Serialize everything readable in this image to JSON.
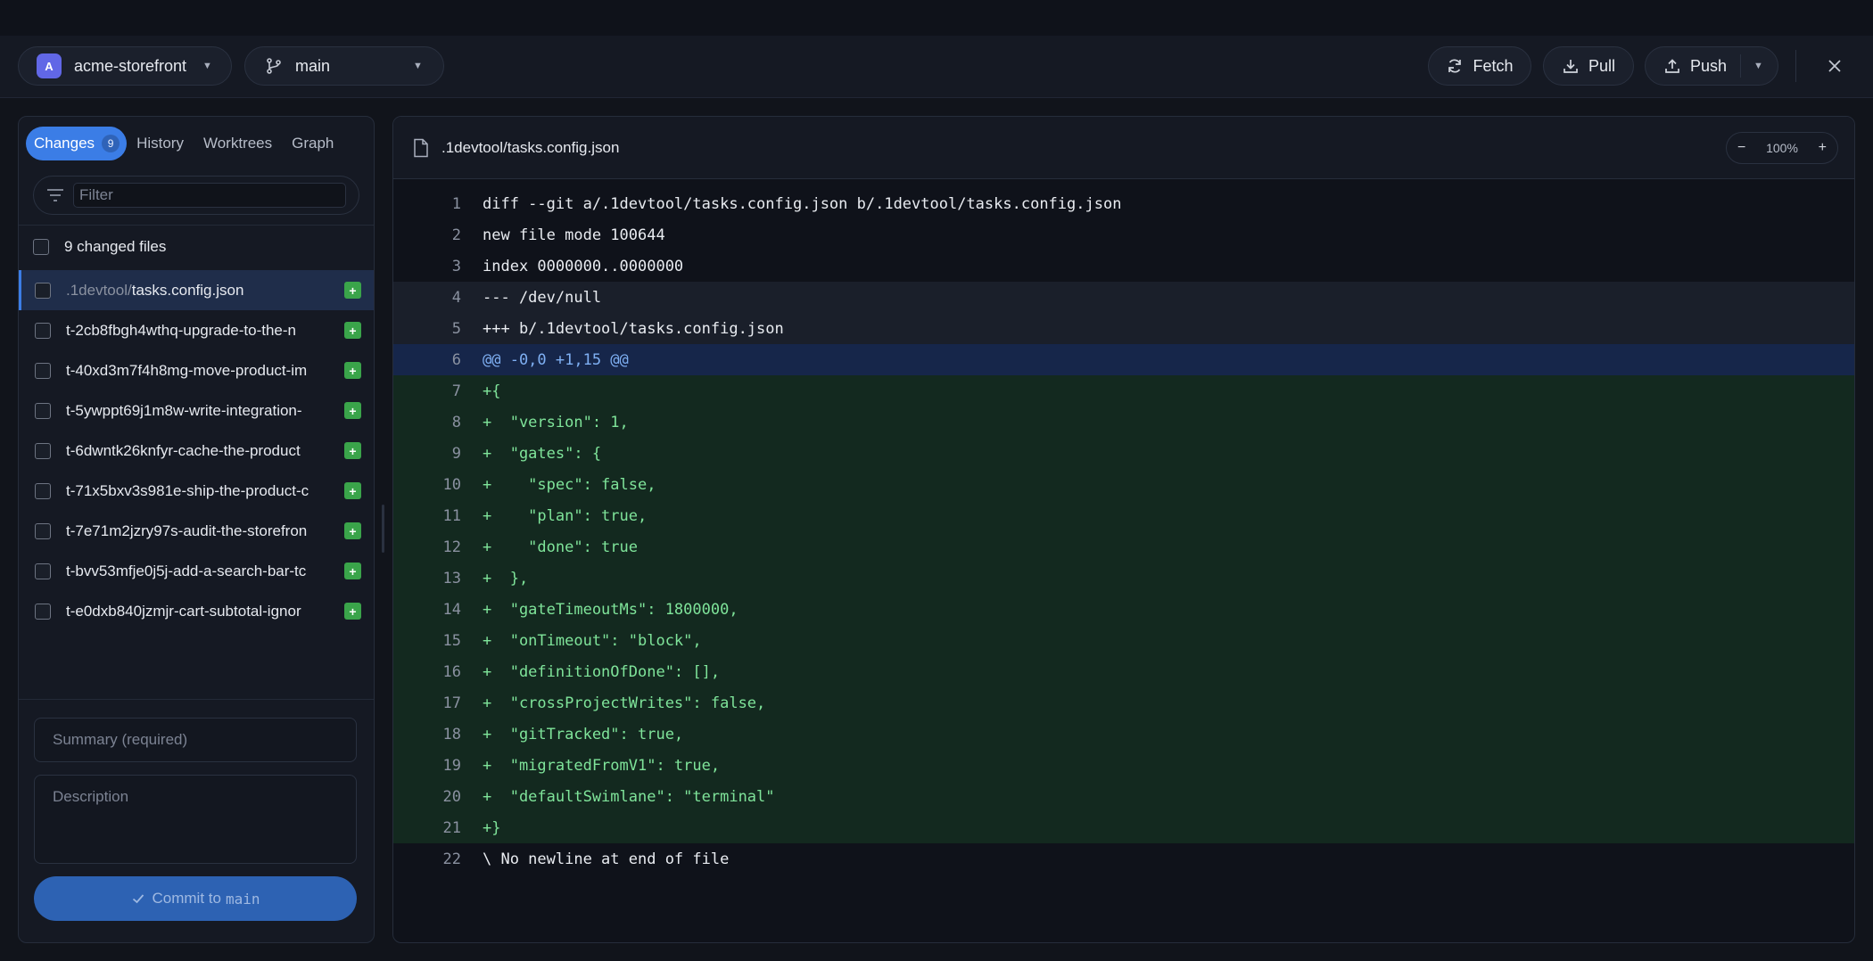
{
  "toolbar": {
    "repo": {
      "avatar_letter": "A",
      "name": "acme-storefront"
    },
    "branch": "main",
    "fetch_label": "Fetch",
    "pull_label": "Pull",
    "push_label": "Push"
  },
  "sidebar": {
    "tabs": [
      {
        "label": "Changes",
        "badge": "9"
      },
      {
        "label": "History"
      },
      {
        "label": "Worktrees"
      },
      {
        "label": "Graph"
      }
    ],
    "filter_placeholder": "Filter",
    "changed_files_label": "9 changed files",
    "files": [
      {
        "dir": ".1devtool/",
        "name": "tasks.config.json",
        "status": "+"
      },
      {
        "dir": "",
        "name": "t-2cb8fbgh4wthq-upgrade-to-the-n",
        "status": "+"
      },
      {
        "dir": "",
        "name": "t-40xd3m7f4h8mg-move-product-im",
        "status": "+"
      },
      {
        "dir": "",
        "name": "t-5ywppt69j1m8w-write-integration-",
        "status": "+"
      },
      {
        "dir": "",
        "name": "t-6dwntk26knfyr-cache-the-product",
        "status": "+"
      },
      {
        "dir": "",
        "name": "t-71x5bxv3s981e-ship-the-product-c",
        "status": "+"
      },
      {
        "dir": "",
        "name": "t-7e71m2jzry97s-audit-the-storefron",
        "status": "+"
      },
      {
        "dir": "",
        "name": "t-bvv53mfje0j5j-add-a-search-bar-tc",
        "status": "+"
      },
      {
        "dir": "",
        "name": "t-e0dxb840jzmjr-cart-subtotal-ignor",
        "status": "+"
      }
    ],
    "summary_placeholder": "Summary (required)",
    "description_placeholder": "Description",
    "commit_label": "Commit to",
    "commit_branch": "main"
  },
  "diff": {
    "path": ".1devtool/tasks.config.json",
    "zoom": "100%",
    "zoom_out": "−",
    "zoom_in": "+",
    "lines": [
      {
        "n": "1",
        "t": "diff --git a/.1devtool/tasks.config.json b/.1devtool/tasks.config.json",
        "k": "ctx"
      },
      {
        "n": "2",
        "t": "new file mode 100644",
        "k": "ctx"
      },
      {
        "n": "3",
        "t": "index 0000000..0000000",
        "k": "ctx"
      },
      {
        "n": "4",
        "t": "--- /dev/null",
        "k": "meta"
      },
      {
        "n": "5",
        "t": "+++ b/.1devtool/tasks.config.json",
        "k": "meta"
      },
      {
        "n": "6",
        "t": "@@ -0,0 +1,15 @@",
        "k": "hunk"
      },
      {
        "n": "7",
        "t": "+{",
        "k": "add"
      },
      {
        "n": "8",
        "t": "+  \"version\": 1,",
        "k": "add"
      },
      {
        "n": "9",
        "t": "+  \"gates\": {",
        "k": "add"
      },
      {
        "n": "10",
        "t": "+    \"spec\": false,",
        "k": "add"
      },
      {
        "n": "11",
        "t": "+    \"plan\": true,",
        "k": "add"
      },
      {
        "n": "12",
        "t": "+    \"done\": true",
        "k": "add"
      },
      {
        "n": "13",
        "t": "+  },",
        "k": "add"
      },
      {
        "n": "14",
        "t": "+  \"gateTimeoutMs\": 1800000,",
        "k": "add"
      },
      {
        "n": "15",
        "t": "+  \"onTimeout\": \"block\",",
        "k": "add"
      },
      {
        "n": "16",
        "t": "+  \"definitionOfDone\": [],",
        "k": "add"
      },
      {
        "n": "17",
        "t": "+  \"crossProjectWrites\": false,",
        "k": "add"
      },
      {
        "n": "18",
        "t": "+  \"gitTracked\": true,",
        "k": "add"
      },
      {
        "n": "19",
        "t": "+  \"migratedFromV1\": true,",
        "k": "add"
      },
      {
        "n": "20",
        "t": "+  \"defaultSwimlane\": \"terminal\"",
        "k": "add"
      },
      {
        "n": "21",
        "t": "+}",
        "k": "add"
      },
      {
        "n": "22",
        "t": "\\ No newline at end of file",
        "k": "ctx"
      }
    ]
  },
  "colors": {
    "accent": "#3b7de6",
    "added": "#3aa44a",
    "add_bg": "#13291f",
    "hunk_bg": "#16264a"
  }
}
